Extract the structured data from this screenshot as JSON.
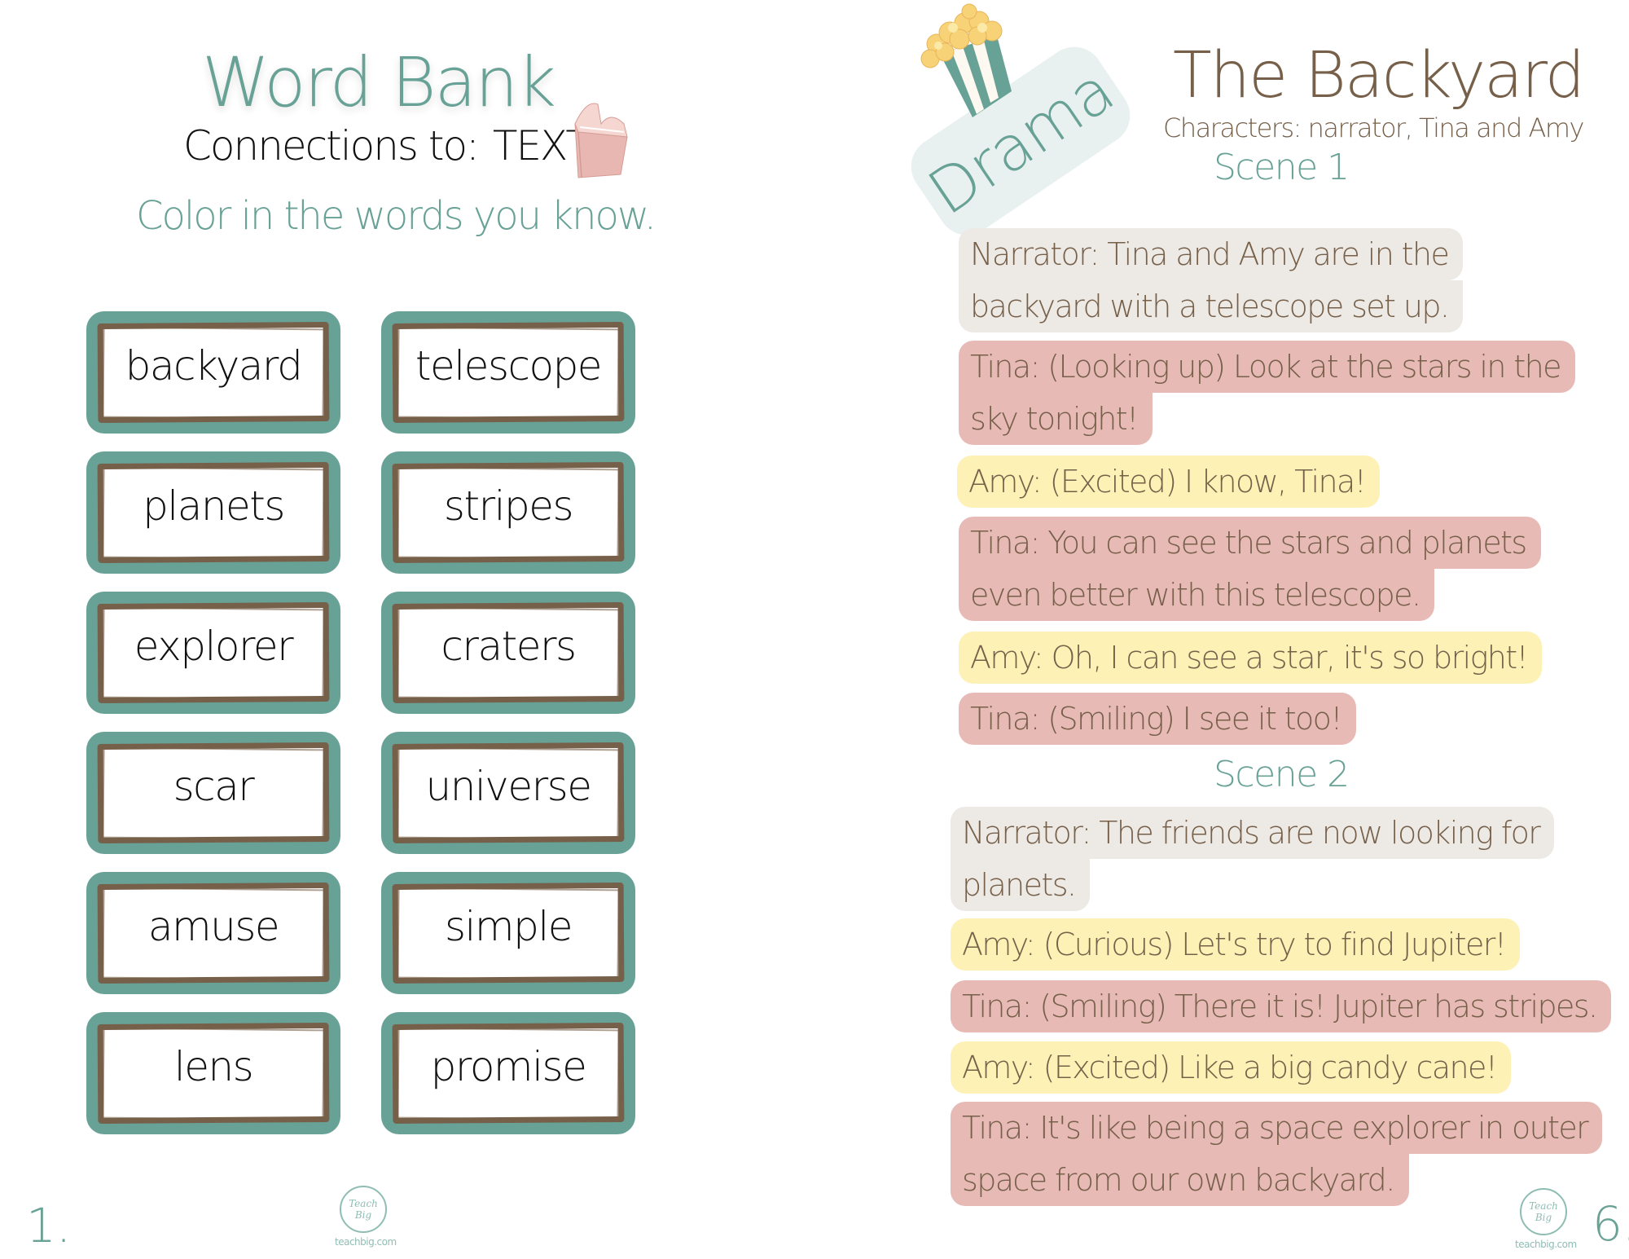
{
  "left_page": {
    "title": "Word Bank",
    "subtitle_prefix": "Connections to:",
    "subtitle_emphasis": "TEXT",
    "instruction": "Color in the words you know.",
    "words": [
      "backyard",
      "telescope",
      "planets",
      "stripes",
      "explorer",
      "craters",
      "scar",
      "universe",
      "amuse",
      "simple",
      "lens",
      "promise"
    ],
    "page_number": "1.",
    "logo": {
      "mark": "Teach Big",
      "url": "teachbig.com"
    },
    "icons": {
      "book": "book-icon"
    }
  },
  "right_page": {
    "badge": "Drama",
    "title": "The Backyard",
    "characters": "Characters: narrator, Tina and Amy",
    "scenes": [
      {
        "heading": "Scene 1",
        "lines": [
          {
            "speaker": "narrator",
            "segments": [
              "Narrator:  Tina and Amy are in the",
              "backyard with a telescope set up."
            ]
          },
          {
            "speaker": "tina",
            "segments": [
              "Tina: (Looking up) Look at the stars in the",
              "sky tonight!"
            ]
          },
          {
            "speaker": "amy",
            "segments": [
              "Amy: (Excited) I know, Tina!"
            ]
          },
          {
            "speaker": "tina",
            "segments": [
              "Tina: You can see the stars and planets",
              "even better with this telescope."
            ]
          },
          {
            "speaker": "amy",
            "segments": [
              "Amy: Oh, I can see a star, it's so bright!"
            ]
          },
          {
            "speaker": "tina",
            "segments": [
              "Tina: (Smiling) I see it too!"
            ]
          }
        ]
      },
      {
        "heading": "Scene 2",
        "lines": [
          {
            "speaker": "narrator",
            "segments": [
              "Narrator: The friends are now looking for",
              "planets."
            ]
          },
          {
            "speaker": "amy",
            "segments": [
              "Amy: (Curious) Let's try to find Jupiter!"
            ]
          },
          {
            "speaker": "tina",
            "segments": [
              "Tina: (Smiling) There it is! Jupiter has stripes."
            ]
          },
          {
            "speaker": "amy",
            "segments": [
              "Amy: (Excited) Like a big candy cane!"
            ]
          },
          {
            "speaker": "tina",
            "segments": [
              "Tina: It's like being a space explorer in outer",
              "space from our own backyard."
            ]
          }
        ]
      }
    ],
    "page_number": "6.",
    "logo": {
      "mark": "Teach Big",
      "url": "teachbig.com"
    },
    "icons": {
      "popcorn": "popcorn-icon"
    }
  },
  "colors": {
    "teal": "#68a195",
    "brown": "#76604a",
    "narrator_bg": "#ede9e4",
    "tina_bg": "#e8bab6",
    "amy_bg": "#fdf1b5",
    "badge_bg": "#e9f1f0",
    "book_pink": "#e8b7b1"
  }
}
